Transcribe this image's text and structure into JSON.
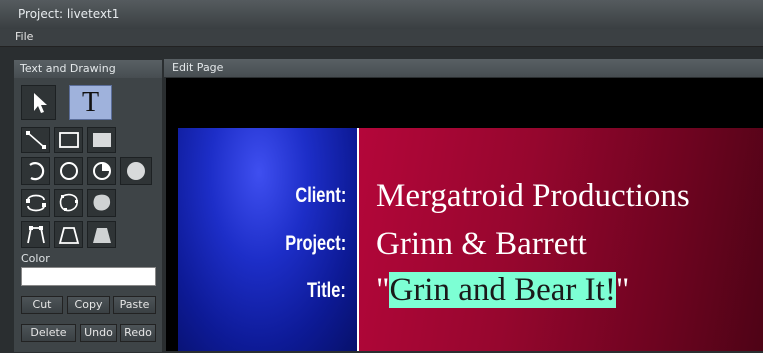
{
  "window": {
    "title": "Project: livetext1"
  },
  "menu": {
    "file": "File"
  },
  "left_panel": {
    "title": "Text and Drawing",
    "color_label": "Color",
    "color_value": "#ffffff",
    "buttons": {
      "cut": "Cut",
      "copy": "Copy",
      "paste": "Paste",
      "delete": "Delete",
      "undo": "Undo",
      "redo": "Redo"
    },
    "tools": [
      "pointer-icon",
      "text-tool-icon",
      "line-icon",
      "rectangle-outline-icon",
      "rectangle-filled-icon",
      "arc-icon",
      "circle-outline-icon",
      "pie-icon",
      "circle-filled-icon",
      "curve-shape-icon",
      "blob-outline-icon",
      "blob-filled-icon",
      "trapezoid-open-icon",
      "trapezoid-outline-icon",
      "trapezoid-filled-icon"
    ],
    "selected_tool": "text-tool-icon",
    "text_tool_glyph": "T"
  },
  "edit_page": {
    "title": "Edit Page",
    "colors": {
      "left_band": "#1d2ec8",
      "right_band": "#96062e",
      "highlight": "#7dffd4"
    },
    "rows": [
      {
        "label": "Client:",
        "value": "Mergatroid Productions"
      },
      {
        "label": "Project:",
        "value": "Grinn & Barrett"
      },
      {
        "label": "Title:",
        "quote_open": "\"",
        "value": "Grin and Bear It!",
        "quote_close": "\""
      }
    ]
  }
}
